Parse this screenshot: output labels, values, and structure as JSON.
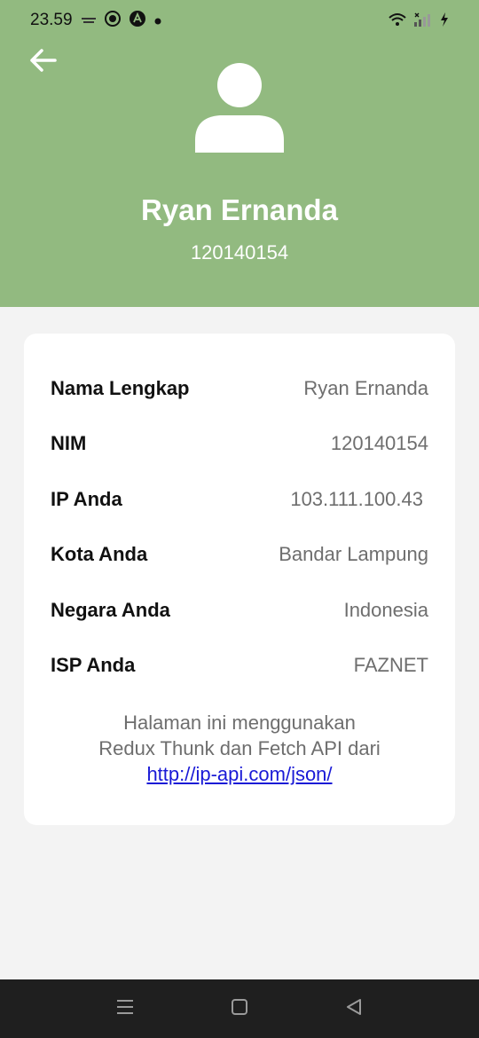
{
  "status_bar": {
    "time": "23.59",
    "left_icons": [
      "notification-app-icon",
      "target-icon",
      "brand-a-icon",
      "dot-icon"
    ],
    "right_icons": [
      "wifi-icon",
      "signal-icon",
      "charging-bolt-icon"
    ]
  },
  "header": {
    "background_color": "#92ba80",
    "back_icon": "arrow-left-icon",
    "avatar_icon": "user-avatar-icon",
    "name": "Ryan Ernanda",
    "nim": "120140154"
  },
  "info": {
    "rows": [
      {
        "label": "Nama Lengkap",
        "value": "Ryan Ernanda"
      },
      {
        "label": "NIM",
        "value": "120140154"
      },
      {
        "label": "IP Anda",
        "value": "103.111.100.43"
      },
      {
        "label": "Kota Anda",
        "value": "Bandar Lampung"
      },
      {
        "label": "Negara Anda",
        "value": "Indonesia"
      },
      {
        "label": "ISP Anda",
        "value": "FAZNET"
      }
    ],
    "note_line1": "Halaman ini menggunakan",
    "note_line2": "Redux Thunk dan Fetch API dari",
    "note_link": "http://ip-api.com/json/"
  },
  "nav_bar": {
    "icons": [
      "menu-icon",
      "home-square-icon",
      "back-triangle-icon"
    ]
  }
}
